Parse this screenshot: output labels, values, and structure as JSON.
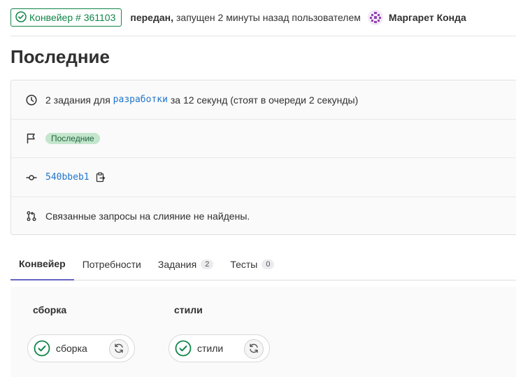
{
  "header": {
    "pipeline_badge": "Конвейер # 361103",
    "status_word": "передан,",
    "started_text": "запущен 2 минуты назад пользователем",
    "author": "Маргарет Конда"
  },
  "page_title": "Последние",
  "info": {
    "jobs_prefix": "2 задания для",
    "jobs_branch": "разработки",
    "jobs_suffix": "за 12 секунд (стоят в очереди 2 секунды)",
    "ref_badge": "Последние",
    "commit_sha": "540bbeb1",
    "merge_requests": "Связанные запросы на слияние не найдены."
  },
  "tabs": [
    {
      "label": "Конвейер",
      "active": true
    },
    {
      "label": "Потребности"
    },
    {
      "label": "Задания",
      "count": "2"
    },
    {
      "label": "Тесты",
      "count": "0"
    }
  ],
  "stages": [
    {
      "title": "сборка",
      "job": "сборка"
    },
    {
      "title": "стили",
      "job": "стили"
    }
  ],
  "colors": {
    "success": "#108548",
    "link": "#1f75cb",
    "tab_active": "#6666c4"
  },
  "icons": {
    "status": "status-success-icon",
    "clock": "clock-icon",
    "flag": "flag-icon",
    "commit": "commit-icon",
    "merge_request": "merge-request-icon",
    "copy": "copy-icon",
    "retry": "retry-icon"
  }
}
